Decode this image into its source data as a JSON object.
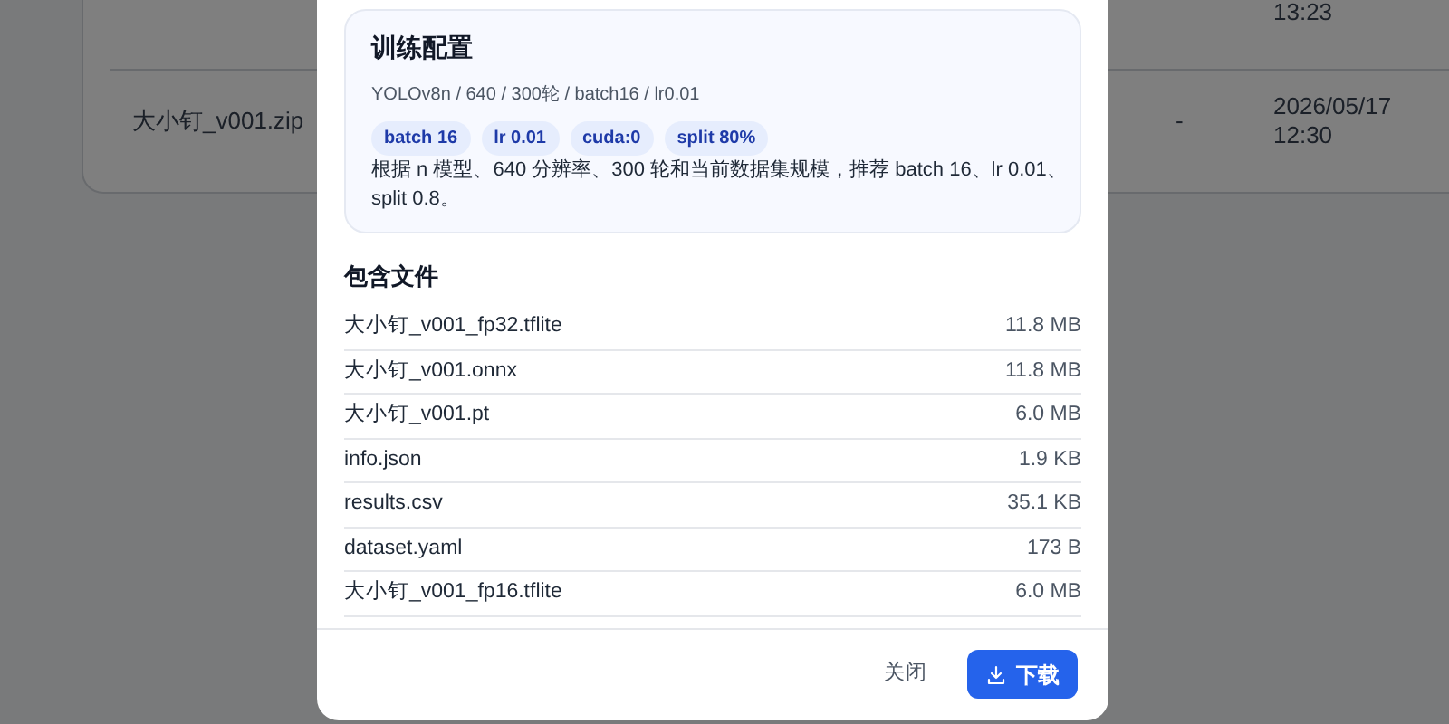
{
  "background_table": {
    "rows": [
      {
        "cells": [
          "",
          "",
          "",
          ""
        ],
        "time": "13:23"
      },
      {
        "cells": [
          "大小钉_v001.zip",
          "",
          "-",
          "2026/05/17"
        ],
        "time": "12:30"
      }
    ]
  },
  "dialog": {
    "config": {
      "title": "训练配置",
      "summary": "YOLOv8n / 640 / 300轮 / batch16 / lr0.01",
      "chips": [
        "batch 16",
        "lr 0.01",
        "cuda:0",
        "split 80%"
      ],
      "description": "根据 n 模型、640 分辨率、300 轮和当前数据集规模，推荐 batch 16、lr 0.01、split 0.8。"
    },
    "files": {
      "title": "包含文件",
      "items": [
        {
          "name": "大小钉_v001_fp32.tflite",
          "size": "11.8 MB"
        },
        {
          "name": "大小钉_v001.onnx",
          "size": "11.8 MB"
        },
        {
          "name": "大小钉_v001.pt",
          "size": "6.0 MB"
        },
        {
          "name": "info.json",
          "size": "1.9 KB"
        },
        {
          "name": "results.csv",
          "size": "35.1 KB"
        },
        {
          "name": "dataset.yaml",
          "size": "173 B"
        },
        {
          "name": "大小钉_v001_fp16.tflite",
          "size": "6.0 MB"
        }
      ]
    },
    "buttons": [
      {
        "kind": "text",
        "label": "关闭"
      },
      {
        "kind": "primary",
        "label": "下载"
      }
    ]
  }
}
